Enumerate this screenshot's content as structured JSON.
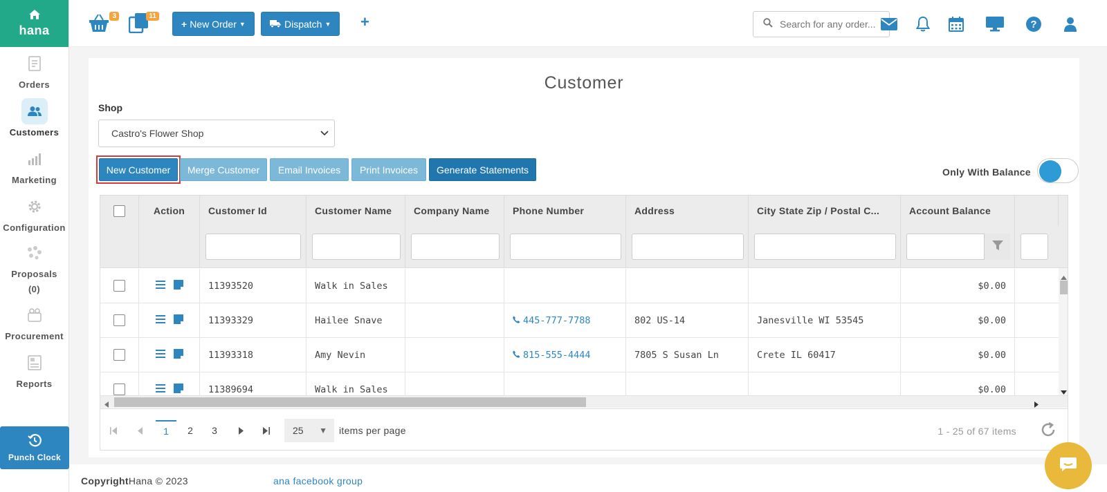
{
  "sidebar": {
    "logo": "hana",
    "items": [
      {
        "label": "Orders",
        "icon": "orders-icon"
      },
      {
        "label": "Customers",
        "icon": "customers-icon"
      },
      {
        "label": "Marketing",
        "icon": "marketing-icon"
      },
      {
        "label": "Configuration",
        "icon": "gear-icon"
      },
      {
        "label": "Proposals",
        "sub": "(0)",
        "icon": "proposals-icon"
      },
      {
        "label": "Procurement",
        "icon": "procurement-icon"
      },
      {
        "label": "Reports",
        "icon": "reports-icon"
      }
    ],
    "active": "Customers",
    "punch_clock": "Punch Clock"
  },
  "topbar": {
    "basket_badge": "3",
    "copies_badge": "11",
    "new_order": "New Order",
    "dispatch": "Dispatch",
    "search_placeholder": "Search for any order..."
  },
  "page": {
    "title": "Customer",
    "shop_label": "Shop",
    "shop_value": "Castro's Flower Shop",
    "buttons": {
      "new_customer": "New Customer",
      "merge_customer": "Merge Customer",
      "email_invoices": "Email Invoices",
      "print_invoices": "Print Invoices",
      "generate_statements": "Generate Statements"
    },
    "only_with_balance": "Only With Balance"
  },
  "grid": {
    "columns": {
      "action": "Action",
      "customer_id": "Customer Id",
      "customer_name": "Customer Name",
      "company_name": "Company Name",
      "phone_number": "Phone Number",
      "address": "Address",
      "city_state_zip": "City State Zip / Postal C...",
      "account_balance": "Account Balance"
    },
    "rows": [
      {
        "id": "11393520",
        "name": "Walk in Sales",
        "company": "",
        "phone": "",
        "address": "",
        "city": "",
        "balance": "$0.00"
      },
      {
        "id": "11393329",
        "name": "Hailee Snave",
        "company": "",
        "phone": "445-777-7788",
        "address": "802 US-14",
        "city": "Janesville WI 53545",
        "balance": "$0.00"
      },
      {
        "id": "11393318",
        "name": "Amy Nevin",
        "company": "",
        "phone": "815-555-4444",
        "address": "7805 S Susan Ln",
        "city": "Crete IL 60417",
        "balance": "$0.00"
      },
      {
        "id": "11389694",
        "name": "Walk in Sales",
        "company": "",
        "phone": "",
        "address": "",
        "city": "",
        "balance": "$0.00"
      }
    ],
    "pager": {
      "pages": [
        "1",
        "2",
        "3"
      ],
      "current": "1",
      "per_page": "25",
      "per_page_label": "items per page",
      "count": "1 - 25 of 67 items"
    }
  },
  "footer": {
    "copyright_bold": "Copyright",
    "copyright_rest": "Hana © 2023",
    "link": "ana facebook group"
  },
  "colors": {
    "brand_green": "#22a98a",
    "primary_blue": "#2e86c1",
    "light_blue": "#7cb9d8",
    "highlight_red": "#d83a3a",
    "badge_orange": "#f5a440",
    "chat_yellow": "#e8b93a"
  }
}
